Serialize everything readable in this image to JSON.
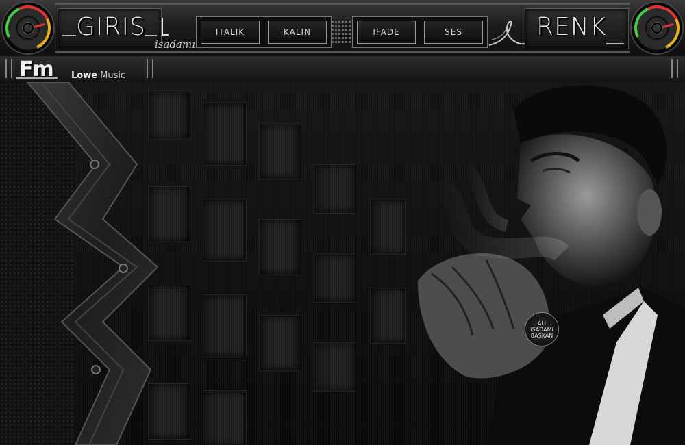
{
  "header": {
    "left_logo": "GIRIS",
    "right_logo": "RENK",
    "signature": "isadamı Ali",
    "buttons": [
      "ITALIK",
      "KALIN",
      "IFADE",
      "SES"
    ]
  },
  "subbar": {
    "brand": "Fm",
    "tagline_bold": "Lowe",
    "tagline_rest": " Music"
  },
  "badge": {
    "line1": "ALi",
    "line2": "iSADAMi",
    "line3": "BAŞKAN"
  },
  "colors": {
    "background": "#0d0d0d",
    "knob_red": "#dd3333",
    "knob_green": "#44cc44",
    "knob_yellow": "#e9b21c"
  },
  "icons": [
    "volume-knob-icon",
    "signature-swirl-icon",
    "grip-icon"
  ]
}
